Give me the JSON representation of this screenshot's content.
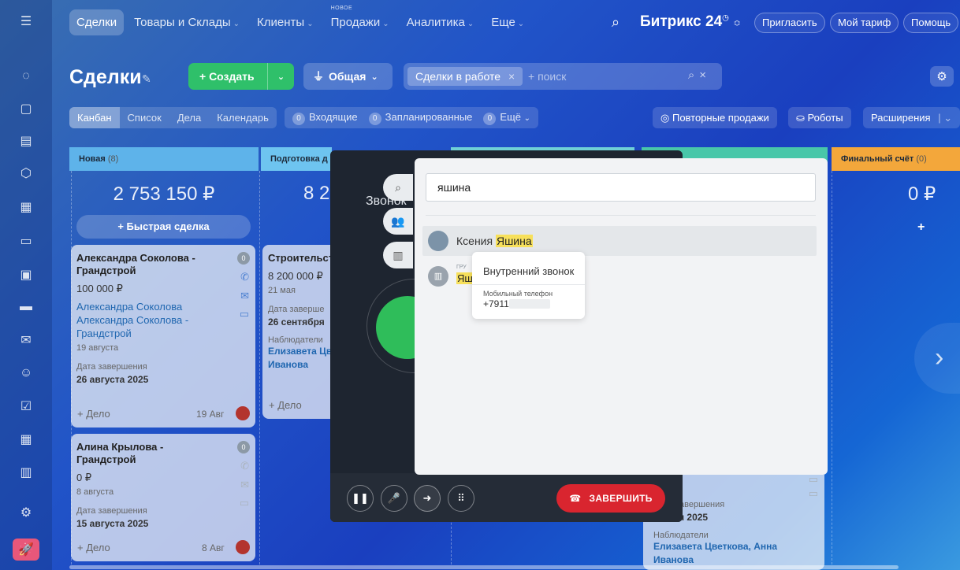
{
  "colors": {
    "accent_green": "#2fc06a",
    "end_call_red": "#d9252f",
    "highlight": "#f7e05b",
    "col_new": "#5eb3ea",
    "col_prep": "#6ec4f0",
    "col_final": "#f3a73b"
  },
  "rail_icons": [
    "menu-icon",
    "chat-icon",
    "feed-icon",
    "tasks-icon",
    "crm-icon",
    "calendar-icon",
    "docs-icon",
    "sites-icon",
    "store-icon",
    "mail-icon",
    "contacts-icon",
    "checklist-icon",
    "timetable-icon",
    "building-icon",
    "settings-icon",
    "rocket-icon"
  ],
  "topnav": {
    "deals": "Сделки",
    "goods": "Товары и Склады",
    "clients": "Клиенты",
    "sales": "Продажи",
    "sales_badge": "НОВОЕ",
    "analytics": "Аналитика",
    "more": "Еще",
    "brand": "Битрикс 24",
    "invite": "Пригласить",
    "tariff": "Мой тариф",
    "help": "Помощь"
  },
  "header": {
    "title": "Сделки",
    "create": "+ Создать",
    "general": "Общая",
    "filter_chip": "Сделки в работе",
    "search_placeholder": "+ поиск"
  },
  "views": {
    "kanban": "Канбан",
    "list": "Список",
    "activities": "Дела",
    "calendar": "Календарь",
    "incoming": "Входящие",
    "planned": "Запланированные",
    "more": "Ещё",
    "incoming_count": "0",
    "planned_count": "0",
    "more_count": "0",
    "repeat_sales": "Повторные продажи",
    "robots": "Роботы",
    "extensions": "Расширения"
  },
  "columns": {
    "new_name": "Новая",
    "new_count": "(8)",
    "new_sum": "2 753 150 ₽",
    "prep_name": "Подготовка д",
    "prep_sum": "8 2",
    "final_name": "Финальный счёт",
    "final_count": "(0)",
    "final_sum": "0 ₽",
    "quick_deal": "+ Быстрая сделка",
    "plus": "+"
  },
  "cards": {
    "c1_title": "Александра Соколова - Грандстрой",
    "c1_sum": "100 000 ₽",
    "c1_contact": "Александра Соколова",
    "c1_company": "Александра Соколова - Грандстрой",
    "c1_created": "19 августа",
    "c1_end_label": "Дата завершения",
    "c1_end": "26 августа 2025",
    "c1_add": "+ Дело",
    "c1_date": "19 Авг",
    "c1_badge": "0",
    "c2_title": "Алина Крылова - Грандстрой",
    "c2_sum": "0 ₽",
    "c2_created": "8 августа",
    "c2_end_label": "Дата завершения",
    "c2_end": "15 августа 2025",
    "c2_add": "+ Дело",
    "c2_date": "8 Авг",
    "c2_badge": "0",
    "c3_title": "Строительст",
    "c3_sum": "8 200 000 ₽",
    "c3_created": "21 мая",
    "c3_end_label": "Дата заверше",
    "c3_end": "26 сентября",
    "c3_obs_label": "Наблюдатели",
    "c3_obs": "Елизавета Цв Иванова",
    "c3_add": "+ Дело",
    "c4_end_label": "завершения",
    "c4_end": "26 мая 2025",
    "c4_obs_label": "Наблюдатели",
    "c4_obs": "Елизавета Цветкова, Анна Иванова"
  },
  "call": {
    "title": "Звонок",
    "end_call": "ЗАВЕРШИТЬ"
  },
  "search": {
    "query": "яшина",
    "r1_first": "Ксения",
    "r1_hl": "Яшина",
    "r2_group": "ГРУ",
    "r2_hl": "Яш"
  },
  "tooltip": {
    "heading": "Внутренний звонок",
    "sub": "Мобильный телефон",
    "phone": "+7911"
  }
}
